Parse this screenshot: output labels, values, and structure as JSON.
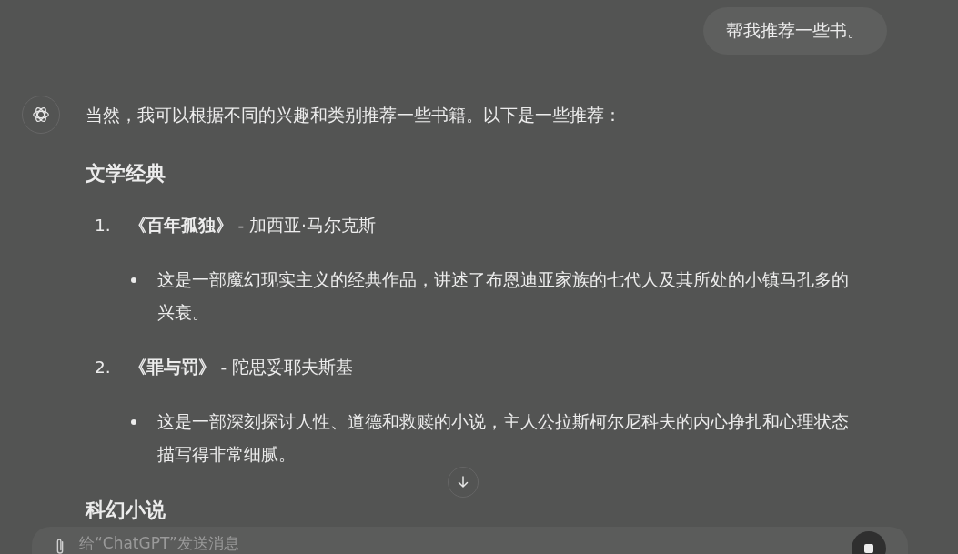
{
  "user_message": "帮我推荐一些书。",
  "assistant": {
    "intro": "当然，我可以根据不同的兴趣和类别推荐一些书籍。以下是一些推荐：",
    "sections": [
      {
        "heading": "文学经典",
        "items": [
          {
            "number": "1.",
            "text": "**《百年孤独》** - 加西亚·马尔克斯",
            "details": [
              "这是一部魔幻现实主义的经典作品，讲述了布恩迪亚家族的七代人及其所处的小镇马孔多的兴衰。"
            ]
          },
          {
            "number": "2.",
            "text": "**《罪与罚》** - 陀思妥耶夫斯基",
            "details": [
              "这是一部深刻探讨人性、道德和救赎的小说，主人公拉斯柯尔尼科夫的内心挣扎和心理状态描写得非常细腻。"
            ]
          }
        ]
      },
      {
        "heading": "科幻小说"
      }
    ]
  },
  "composer": {
    "placeholder": "给“ChatGPT”发送消息"
  }
}
